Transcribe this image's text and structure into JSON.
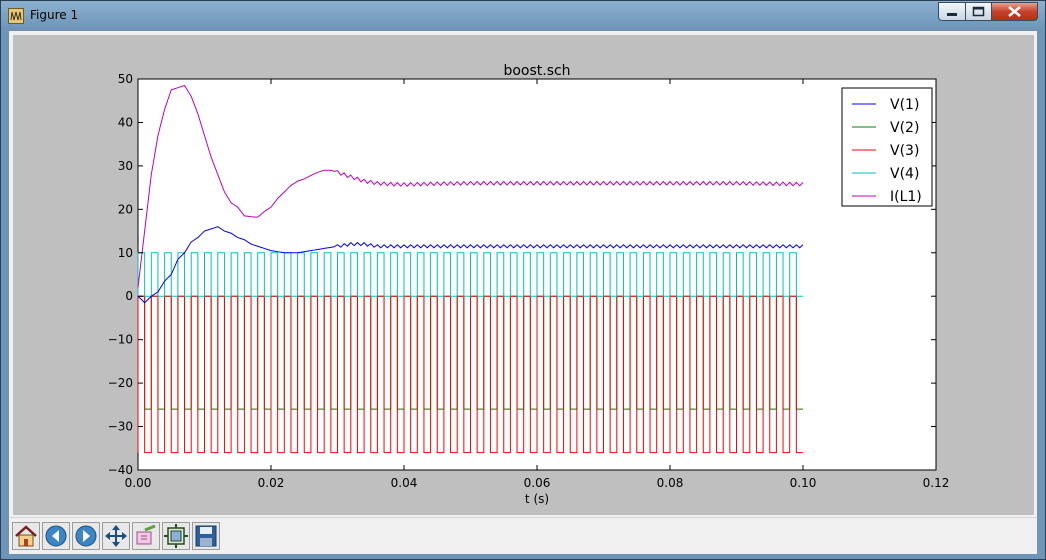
{
  "window": {
    "title": "Figure 1",
    "controls": {
      "minimize": "minimize",
      "maximize": "maximize",
      "close": "close"
    }
  },
  "toolbar": {
    "buttons": [
      {
        "name": "home-button",
        "icon": "home-icon",
        "label": "Home"
      },
      {
        "name": "back-button",
        "icon": "arrow-left-icon",
        "label": "Back"
      },
      {
        "name": "forward-button",
        "icon": "arrow-right-icon",
        "label": "Forward"
      },
      {
        "name": "pan-button",
        "icon": "pan-arrows-icon",
        "label": "Pan"
      },
      {
        "name": "zoom-button",
        "icon": "zoom-rect-icon",
        "label": "Zoom"
      },
      {
        "name": "subplots-button",
        "icon": "subplots-icon",
        "label": "Subplots"
      },
      {
        "name": "save-button",
        "icon": "floppy-disk-icon",
        "label": "Save"
      }
    ]
  },
  "chart_data": {
    "type": "line",
    "title": "boost.sch",
    "xlabel": "t (s)",
    "ylabel": "",
    "xlim": [
      0.0,
      0.12
    ],
    "ylim": [
      -40,
      50
    ],
    "xticks": [
      "0.00",
      "0.02",
      "0.04",
      "0.06",
      "0.08",
      "0.10",
      "0.12"
    ],
    "yticks": [
      "−40",
      "−30",
      "−20",
      "−10",
      "0",
      "10",
      "20",
      "30",
      "40",
      "50"
    ],
    "legend_position": "upper-right",
    "grid": false,
    "series": [
      {
        "name": "V(1)",
        "color": "#0000ff",
        "x": [
          0,
          0.001,
          0.002,
          0.003,
          0.004,
          0.005,
          0.006,
          0.007,
          0.008,
          0.009,
          0.01,
          0.011,
          0.012,
          0.013,
          0.014,
          0.015,
          0.016,
          0.017,
          0.018,
          0.019,
          0.02,
          0.022,
          0.024,
          0.026,
          0.028,
          0.03,
          0.032,
          0.034,
          0.036,
          0.038,
          0.04,
          0.05,
          0.06,
          0.07,
          0.08,
          0.09,
          0.1
        ],
        "y": [
          0,
          -1.5,
          0,
          1,
          3.5,
          5,
          8.5,
          10,
          12.5,
          13.5,
          15,
          15.5,
          16,
          15,
          14.5,
          13.5,
          13,
          12,
          11.5,
          11,
          10.5,
          10,
          10,
          10.5,
          11,
          11.5,
          12,
          12,
          11.5,
          11.5,
          11.5,
          11.5,
          11.5,
          11.5,
          11.5,
          11.5,
          11.5
        ],
        "ripple": 0.7
      },
      {
        "name": "V(2)",
        "color": "#008000",
        "pulse": {
          "high": 0,
          "low": -26,
          "period": 0.002,
          "start": 0.0,
          "end": 0.1
        }
      },
      {
        "name": "V(3)",
        "color": "#ff0000",
        "pulse": {
          "high": 0,
          "low": -36,
          "period": 0.002,
          "start": 0.0,
          "end": 0.1
        }
      },
      {
        "name": "V(4)",
        "color": "#00bfbf",
        "pulse": {
          "high": 10,
          "low": 0,
          "period": 0.002,
          "start": 0.0,
          "end": 0.1
        }
      },
      {
        "name": "I(L1)",
        "color": "#bf00bf",
        "x": [
          0,
          0.001,
          0.002,
          0.003,
          0.004,
          0.005,
          0.006,
          0.007,
          0.008,
          0.009,
          0.01,
          0.011,
          0.012,
          0.013,
          0.014,
          0.015,
          0.016,
          0.017,
          0.018,
          0.019,
          0.02,
          0.021,
          0.022,
          0.023,
          0.024,
          0.025,
          0.026,
          0.027,
          0.028,
          0.029,
          0.03,
          0.032,
          0.034,
          0.036,
          0.038,
          0.04,
          0.045,
          0.05,
          0.06,
          0.07,
          0.08,
          0.09,
          0.1
        ],
        "y": [
          2,
          15,
          28,
          37,
          43,
          47.5,
          48,
          48.5,
          46,
          42,
          37,
          32,
          28,
          24,
          21.5,
          20.5,
          18.5,
          18.3,
          18.2,
          19.5,
          20.5,
          22.5,
          24,
          25.5,
          26.5,
          27,
          27.8,
          28.5,
          29,
          29,
          28.5,
          27.5,
          26.5,
          26,
          25.8,
          25.7,
          25.9,
          26,
          26,
          26,
          26,
          26,
          25.8
        ],
        "ripple": 0.8
      }
    ]
  }
}
